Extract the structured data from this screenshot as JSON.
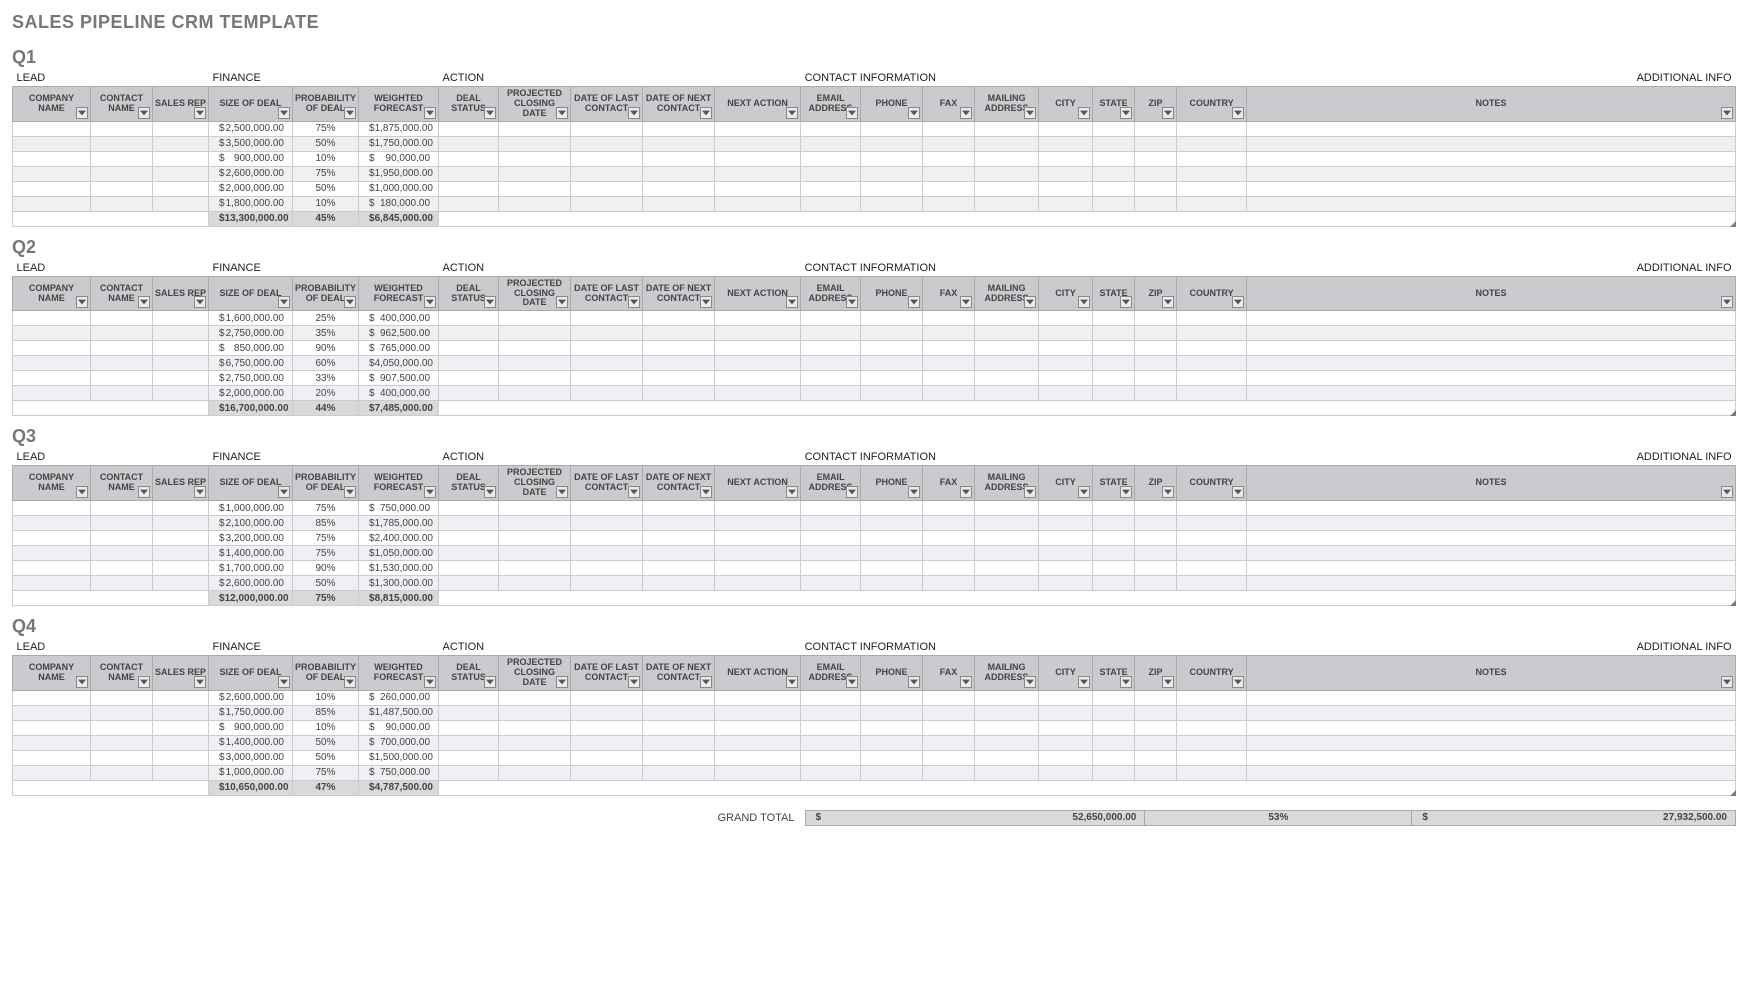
{
  "title": "SALES PIPELINE CRM TEMPLATE",
  "groupHeaders": {
    "lead": "LEAD",
    "finance": "FINANCE",
    "action": "ACTION",
    "contact": "CONTACT INFORMATION",
    "additional": "ADDITIONAL INFO"
  },
  "columns": [
    "COMPANY NAME",
    "CONTACT NAME",
    "SALES REP",
    "SIZE OF DEAL",
    "PROBABILITY OF DEAL",
    "WEIGHTED FORECAST",
    "DEAL STATUS",
    "PROJECTED CLOSING DATE",
    "DATE OF LAST CONTACT",
    "DATE OF NEXT CONTACT",
    "NEXT ACTION",
    "EMAIL ADDRESS",
    "PHONE",
    "FAX",
    "MAILING ADDRESS",
    "CITY",
    "STATE",
    "ZIP",
    "COUNTRY",
    "NOTES"
  ],
  "quarters": [
    {
      "name": "Q1",
      "rows": [
        {
          "size": "2,500,000.00",
          "prob": "75%",
          "forecast": "1,875,000.00"
        },
        {
          "size": "3,500,000.00",
          "prob": "50%",
          "forecast": "1,750,000.00"
        },
        {
          "size": "900,000.00",
          "prob": "10%",
          "forecast": "90,000.00"
        },
        {
          "size": "2,600,000.00",
          "prob": "75%",
          "forecast": "1,950,000.00"
        },
        {
          "size": "2,000,000.00",
          "prob": "50%",
          "forecast": "1,000,000.00"
        },
        {
          "size": "1,800,000.00",
          "prob": "10%",
          "forecast": "180,000.00"
        }
      ],
      "total": {
        "size": "13,300,000.00",
        "prob": "45%",
        "forecast": "6,845,000.00"
      }
    },
    {
      "name": "Q2",
      "rows": [
        {
          "size": "1,600,000.00",
          "prob": "25%",
          "forecast": "400,000.00"
        },
        {
          "size": "2,750,000.00",
          "prob": "35%",
          "forecast": "962,500.00"
        },
        {
          "size": "850,000.00",
          "prob": "90%",
          "forecast": "765,000.00"
        },
        {
          "size": "6,750,000.00",
          "prob": "60%",
          "forecast": "4,050,000.00"
        },
        {
          "size": "2,750,000.00",
          "prob": "33%",
          "forecast": "907,500.00"
        },
        {
          "size": "2,000,000.00",
          "prob": "20%",
          "forecast": "400,000.00"
        }
      ],
      "total": {
        "size": "16,700,000.00",
        "prob": "44%",
        "forecast": "7,485,000.00"
      }
    },
    {
      "name": "Q3",
      "rows": [
        {
          "size": "1,000,000.00",
          "prob": "75%",
          "forecast": "750,000.00"
        },
        {
          "size": "2,100,000.00",
          "prob": "85%",
          "forecast": "1,785,000.00"
        },
        {
          "size": "3,200,000.00",
          "prob": "75%",
          "forecast": "2,400,000.00"
        },
        {
          "size": "1,400,000.00",
          "prob": "75%",
          "forecast": "1,050,000.00"
        },
        {
          "size": "1,700,000.00",
          "prob": "90%",
          "forecast": "1,530,000.00"
        },
        {
          "size": "2,600,000.00",
          "prob": "50%",
          "forecast": "1,300,000.00"
        }
      ],
      "total": {
        "size": "12,000,000.00",
        "prob": "75%",
        "forecast": "8,815,000.00"
      }
    },
    {
      "name": "Q4",
      "rows": [
        {
          "size": "2,600,000.00",
          "prob": "10%",
          "forecast": "260,000.00"
        },
        {
          "size": "1,750,000.00",
          "prob": "85%",
          "forecast": "1,487,500.00"
        },
        {
          "size": "900,000.00",
          "prob": "10%",
          "forecast": "90,000.00"
        },
        {
          "size": "1,400,000.00",
          "prob": "50%",
          "forecast": "700,000.00"
        },
        {
          "size": "3,000,000.00",
          "prob": "50%",
          "forecast": "1,500,000.00"
        },
        {
          "size": "1,000,000.00",
          "prob": "75%",
          "forecast": "750,000.00"
        }
      ],
      "total": {
        "size": "10,650,000.00",
        "prob": "47%",
        "forecast": "4,787,500.00"
      }
    }
  ],
  "grandTotal": {
    "label": "GRAND TOTAL",
    "size": "52,650,000.00",
    "prob": "53%",
    "forecast": "27,932,500.00"
  }
}
